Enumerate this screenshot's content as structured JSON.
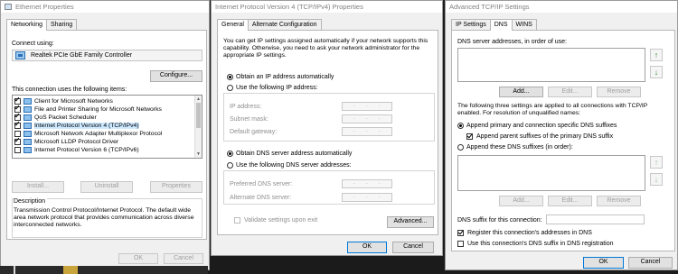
{
  "win1": {
    "title": "Ethernet Properties",
    "tabs": [
      "Networking",
      "Sharing"
    ],
    "connect_using": "Connect using:",
    "adapter": "Realtek PCIe GbE Family Controller",
    "configure": "Configure...",
    "items_label": "This connection uses the following items:",
    "items": [
      {
        "text": "Client for Microsoft Networks",
        "checked": true
      },
      {
        "text": "File and Printer Sharing for Microsoft Networks",
        "checked": true
      },
      {
        "text": "QoS Packet Scheduler",
        "checked": true
      },
      {
        "text": "Internet Protocol Version 4 (TCP/IPv4)",
        "checked": true
      },
      {
        "text": "Microsoft Network Adapter Multiplexor Protocol",
        "checked": false
      },
      {
        "text": "Microsoft LLDP Protocol Driver",
        "checked": true
      },
      {
        "text": "Internet Protocol Version 6 (TCP/IPv6)",
        "checked": false
      }
    ],
    "install": "Install...",
    "uninstall": "Uninstall",
    "properties": "Properties",
    "desc_title": "Description",
    "desc_text": "Transmission Control Protocol/Internet Protocol. The default wide area network protocol that provides communication across diverse interconnected networks.",
    "ok": "OK",
    "cancel": "Cancel"
  },
  "win2": {
    "title": "Internet Protocol Version 4 (TCP/IPv4) Properties",
    "tabs": [
      "General",
      "Alternate Configuration"
    ],
    "intro": "You can get IP settings assigned automatically if your network supports this capability. Otherwise, you need to ask your network administrator for the appropriate IP settings.",
    "obtain_ip": "Obtain an IP address automatically",
    "use_ip": "Use the following IP address:",
    "ip_address": "IP address:",
    "subnet": "Subnet mask:",
    "gateway": "Default gateway:",
    "obtain_dns": "Obtain DNS server address automatically",
    "use_dns": "Use the following DNS server addresses:",
    "preferred_dns": "Preferred DNS server:",
    "alternate_dns": "Alternate DNS server:",
    "validate": "Validate settings upon exit",
    "advanced": "Advanced...",
    "ok": "OK",
    "cancel": "Cancel"
  },
  "win3": {
    "title": "Advanced TCP/IP Settings",
    "tabs": [
      "IP Settings",
      "DNS",
      "WINS"
    ],
    "dns_servers_label": "DNS server addresses, in order of use:",
    "add": "Add...",
    "edit": "Edit...",
    "remove": "Remove",
    "three_settings": "The following three settings are applied to all connections with TCP/IP enabled. For resolution of unqualified names:",
    "append_primary": "Append primary and connection specific DNS suffixes",
    "append_parent": "Append parent suffixes of the primary DNS suffix",
    "append_these": "Append these DNS suffixes (in order):",
    "suffix_label": "DNS suffix for this connection:",
    "register": "Register this connection's addresses in DNS",
    "use_suffix": "Use this connection's DNS suffix in DNS registration",
    "ok": "OK",
    "cancel": "Cancel"
  }
}
